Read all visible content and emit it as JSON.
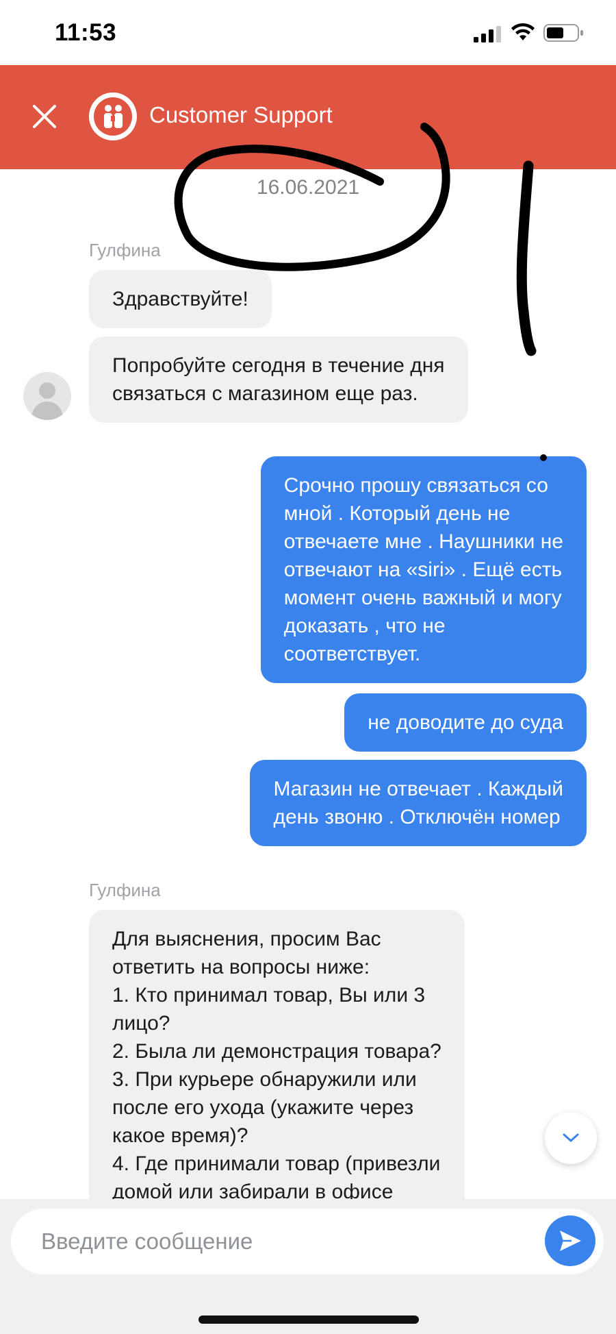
{
  "status_bar": {
    "time": "11:53"
  },
  "header": {
    "title": "Customer Support",
    "close_icon": "close-icon",
    "logo_icon": "support-logo-icon",
    "background_color": "#e05442"
  },
  "chat": {
    "date": "16.06.2021",
    "messages": [
      {
        "direction": "in",
        "sender": "Гулфина",
        "text": "Здравствуйте!"
      },
      {
        "direction": "in",
        "text": "Попробуйте сегодня в течение дня\nсвязаться с магазином еще раз."
      },
      {
        "direction": "out",
        "text": "Срочно прошу связаться со\nмной . Который день не\nотвечаете мне . Наушники не\nотвечают на «siri» . Ещё есть\nмомент очень важный и могу\nдоказать , что не\nсоответствует."
      },
      {
        "direction": "out",
        "text": "не доводите до суда"
      },
      {
        "direction": "out",
        "text": "Магазин не отвечает . Каждый\nдень звоню . Отключён номер"
      },
      {
        "direction": "in",
        "sender": "Гулфина",
        "text": "Для выяснения, просим Вас\nответить на вопросы ниже:\n1. Кто принимал товар, Вы или 3\nлицо?\n2. Была ли демонстрация товара?\n3. При курьере обнаружили или\nпосле его ухода (укажите через\nкакое время)?\n4. Где принимали товар (привезли\nдомой или забирали в офисе"
      }
    ]
  },
  "composer": {
    "placeholder": "Введите сообщение",
    "send_icon": "send-icon"
  },
  "colors": {
    "outgoing_bubble": "#3a82ec",
    "incoming_bubble": "#f0f0f1",
    "accent": "#3a82ec"
  }
}
